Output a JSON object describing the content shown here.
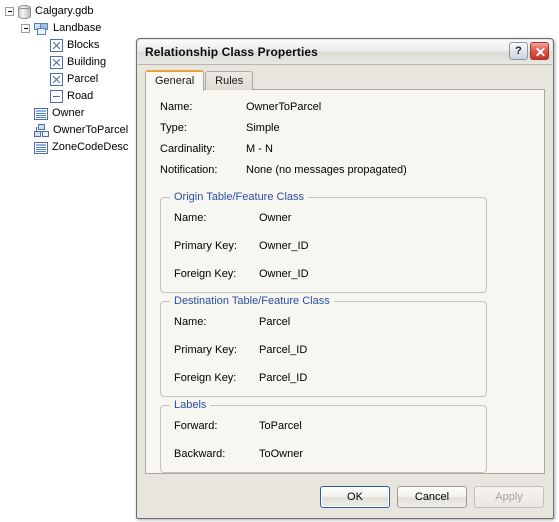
{
  "catalog_tree": {
    "items": [
      {
        "label": "Calgary.gdb",
        "icon": "geodatabase-icon",
        "indent": 0,
        "expander": "minus"
      },
      {
        "label": "Landbase",
        "icon": "feature-dataset-icon",
        "indent": 1,
        "expander": "minus"
      },
      {
        "label": "Blocks",
        "icon": "feature-class-icon",
        "indent": 2,
        "expander": "none"
      },
      {
        "label": "Building",
        "icon": "feature-class-icon",
        "indent": 2,
        "expander": "none"
      },
      {
        "label": "Parcel",
        "icon": "feature-class-icon",
        "indent": 2,
        "expander": "none"
      },
      {
        "label": "Road",
        "icon": "line-feature-class-icon",
        "indent": 2,
        "expander": "none"
      },
      {
        "label": "Owner",
        "icon": "table-icon",
        "indent": 1,
        "expander": "none"
      },
      {
        "label": "OwnerToParcel",
        "icon": "relationship-class-icon",
        "indent": 1,
        "expander": "none"
      },
      {
        "label": "ZoneCodeDesc",
        "icon": "table-icon",
        "indent": 1,
        "expander": "none"
      }
    ]
  },
  "dialog": {
    "title": "Relationship Class Properties",
    "help_button": "?",
    "close_button": "×",
    "tabs": [
      {
        "label": "General",
        "active": true
      },
      {
        "label": "Rules",
        "active": false
      }
    ],
    "general": {
      "fields": [
        {
          "label": "Name:",
          "value": "OwnerToParcel"
        },
        {
          "label": "Type:",
          "value": "Simple"
        },
        {
          "label": "Cardinality:",
          "value": "M - N"
        },
        {
          "label": "Notification:",
          "value": "None (no messages propagated)"
        }
      ],
      "origin_group": {
        "legend": "Origin Table/Feature Class",
        "rows": [
          {
            "label": "Name:",
            "value": "Owner"
          },
          {
            "label": "Primary Key:",
            "value": "Owner_ID"
          },
          {
            "label": "Foreign Key:",
            "value": "Owner_ID"
          }
        ]
      },
      "destination_group": {
        "legend": "Destination Table/Feature Class",
        "rows": [
          {
            "label": "Name:",
            "value": "Parcel"
          },
          {
            "label": "Primary Key:",
            "value": "Parcel_ID"
          },
          {
            "label": "Foreign Key:",
            "value": "Parcel_ID"
          }
        ]
      },
      "labels_group": {
        "legend": "Labels",
        "rows": [
          {
            "label": "Forward:",
            "value": "ToParcel"
          },
          {
            "label": "Backward:",
            "value": "ToOwner"
          }
        ]
      }
    },
    "buttons": [
      {
        "label": "OK",
        "state": "default"
      },
      {
        "label": "Cancel",
        "state": "normal"
      },
      {
        "label": "Apply",
        "state": "disabled"
      }
    ]
  },
  "colors": {
    "group_legend": "#2a4fa8",
    "active_tab_accent": "#e8a33d",
    "close_button": "#c4352b",
    "dialog_chrome": "#e7e5de",
    "panel_bg": "#f7f6f1"
  }
}
